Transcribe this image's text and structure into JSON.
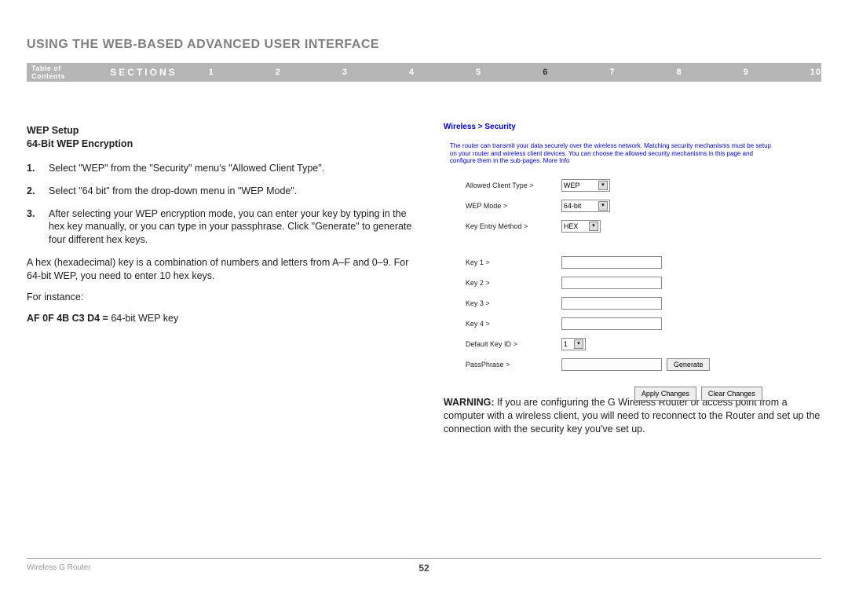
{
  "header": {
    "title": "USING THE WEB-BASED ADVANCED USER INTERFACE"
  },
  "nav": {
    "toc": "Table of Contents",
    "sections_label": "SECTIONS",
    "items": [
      "1",
      "2",
      "3",
      "4",
      "5",
      "6",
      "7",
      "8",
      "9",
      "10"
    ],
    "active": "6"
  },
  "left": {
    "heading1": "WEP Setup",
    "heading2": "64-Bit WEP Encryption",
    "steps": [
      "Select \"WEP\" from the \"Security\" menu's \"Allowed Client Type\".",
      "Select \"64 bit\" from the drop-down menu in \"WEP Mode\".",
      "After selecting your WEP encryption mode, you can enter your key by typing in the hex key manually, or you can type in your passphrase. Click \"Generate\" to generate four different hex keys."
    ],
    "para1": "A hex (hexadecimal) key is a combination of numbers and letters from A–F and 0–9. For 64-bit WEP, you need to enter 10 hex keys.",
    "para2": "For instance:",
    "example_bold": "AF 0F 4B C3 D4 = ",
    "example_rest": "64-bit WEP key"
  },
  "screenshot": {
    "breadcrumb": "Wireless > Security",
    "intro": "The router can transmit your data securely over the wireless network. Matching security mechanisms must be setup on your router and wireless client devices. You can choose the allowed security mechanisms in this page and configure them in the sub-pages. More Info",
    "rows": {
      "allowed_client": {
        "label": "Allowed Client Type >",
        "value": "WEP"
      },
      "wep_mode": {
        "label": "WEP Mode >",
        "value": "64-bit"
      },
      "key_entry": {
        "label": "Key Entry Method >",
        "value": "HEX"
      },
      "key1": {
        "label": "Key 1 >"
      },
      "key2": {
        "label": "Key 2 >"
      },
      "key3": {
        "label": "Key 3 >"
      },
      "key4": {
        "label": "Key 4 >"
      },
      "default_key": {
        "label": "Default Key ID >",
        "value": "1"
      },
      "passphrase": {
        "label": "PassPhrase >"
      }
    },
    "buttons": {
      "generate": "Generate",
      "apply": "Apply Changes",
      "clear": "Clear Changes"
    }
  },
  "warning": {
    "label": "WARNING: ",
    "text": "If you are configuring the G Wireless Router or access point from a computer with a wireless client, you will need to reconnect to the Router and set up the connection with the security key you've set up."
  },
  "footer": {
    "product": "Wireless G Router",
    "page": "52"
  }
}
